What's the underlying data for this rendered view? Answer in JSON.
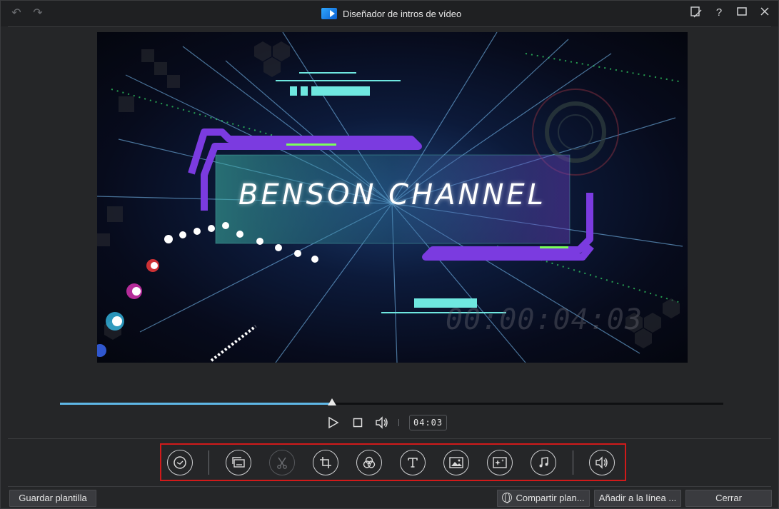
{
  "window": {
    "title": "Diseñador de intros de vídeo"
  },
  "titlebar": {
    "undo_icon": "undo-arrow-icon",
    "redo_icon": "redo-arrow-icon",
    "buttons": [
      "feedback-icon",
      "help-icon",
      "maximize-icon",
      "close-icon"
    ]
  },
  "preview": {
    "channel_name": "BENSON CHANNEL",
    "ghost_timecode": "00:00:04:03"
  },
  "timeline": {
    "progress": 0.41,
    "current_time": "04:03"
  },
  "transport": {
    "icons": [
      "play-icon",
      "stop-icon",
      "volume-icon"
    ]
  },
  "tools": [
    {
      "name": "duration-tool",
      "icon": "clock-icon",
      "enabled": true
    },
    {
      "name": "replace-media-tool",
      "icon": "replace-media-icon",
      "enabled": true
    },
    {
      "name": "trim-tool",
      "icon": "scissors-icon",
      "enabled": false
    },
    {
      "name": "crop-tool",
      "icon": "crop-icon",
      "enabled": true
    },
    {
      "name": "blend-tool",
      "icon": "blend-circles-icon",
      "enabled": true
    },
    {
      "name": "title-tool",
      "icon": "text-T-icon",
      "enabled": true
    },
    {
      "name": "image-tool",
      "icon": "image-icon",
      "enabled": true
    },
    {
      "name": "effects-tool",
      "icon": "sparkle-effect-icon",
      "enabled": true
    },
    {
      "name": "music-tool",
      "icon": "music-note-icon",
      "enabled": true
    },
    {
      "name": "audio-tool",
      "icon": "speaker-icon",
      "enabled": true
    }
  ],
  "buttons": {
    "save_template": "Guardar plantilla",
    "share": "Compartir plan...",
    "add_to_timeline": "Añadir a la línea ...",
    "close": "Cerrar"
  },
  "colors": {
    "accent": "#5fb7e6",
    "highlight_box": "#d11a1a",
    "frame_purple": "#7b3be0",
    "cyan_bar": "#6fe8e0"
  }
}
